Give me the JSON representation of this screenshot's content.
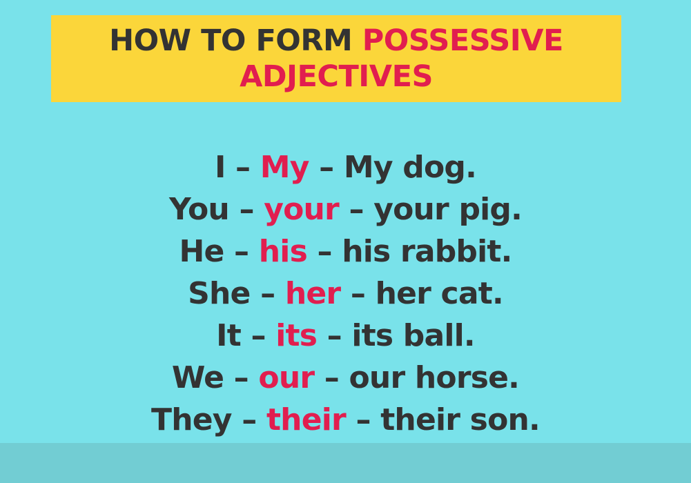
{
  "title": {
    "part1": "HOW TO FORM ",
    "part2": "POSSESSIVE",
    "line2": "ADJECTIVES"
  },
  "rows": [
    {
      "pronoun": "I",
      "sep1": " – ",
      "adjective": "My",
      "sep2": " – ",
      "example": "My dog."
    },
    {
      "pronoun": "You",
      "sep1": " – ",
      "adjective": "your",
      "sep2": " – ",
      "example": "your pig."
    },
    {
      "pronoun": "He",
      "sep1": " – ",
      "adjective": "his",
      "sep2": " – ",
      "example": "his rabbit."
    },
    {
      "pronoun": "She",
      "sep1": " – ",
      "adjective": "her",
      "sep2": " – ",
      "example": "her cat."
    },
    {
      "pronoun": "It",
      "sep1": " – ",
      "adjective": "its",
      "sep2": " – ",
      "example": "its ball."
    },
    {
      "pronoun": "We",
      "sep1": " – ",
      "adjective": "our",
      "sep2": " – ",
      "example": "our horse."
    },
    {
      "pronoun": "They",
      "sep1": " – ",
      "adjective": "their",
      "sep2": " – ",
      "example": "their son."
    }
  ],
  "colors": {
    "background": "#79e2ea",
    "title_box": "#fbd63a",
    "text_dark": "#333333",
    "accent_red": "#e11e4f",
    "bottom_band": "#72cdd3"
  }
}
